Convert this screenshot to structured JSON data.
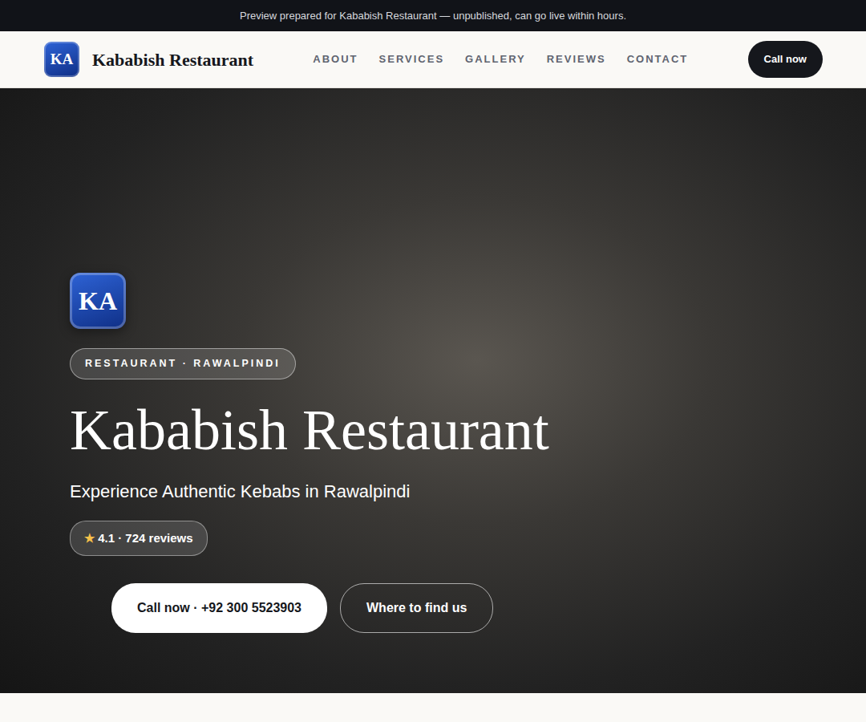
{
  "banner": "Preview prepared for Kababish Restaurant — unpublished, can go live within hours.",
  "logo": {
    "initials": "KA"
  },
  "brand": "Kababish Restaurant",
  "nav": [
    {
      "label": "ABOUT"
    },
    {
      "label": "SERVICES"
    },
    {
      "label": "GALLERY"
    },
    {
      "label": "REVIEWS"
    },
    {
      "label": "CONTACT"
    }
  ],
  "nav_button": "Call now",
  "hero": {
    "badge": "RESTAURANT · RAWALPINDI",
    "title": "Kababish Restaurant",
    "subtitle": "Experience Authentic Kebabs in Rawalpindi",
    "rating": {
      "star": "★",
      "text": "4.1 · 724 reviews"
    },
    "buttons": [
      {
        "label": "Call now · +92 300 5523903",
        "kind": "solid"
      },
      {
        "label": "Where to find us",
        "kind": "outline"
      }
    ]
  }
}
